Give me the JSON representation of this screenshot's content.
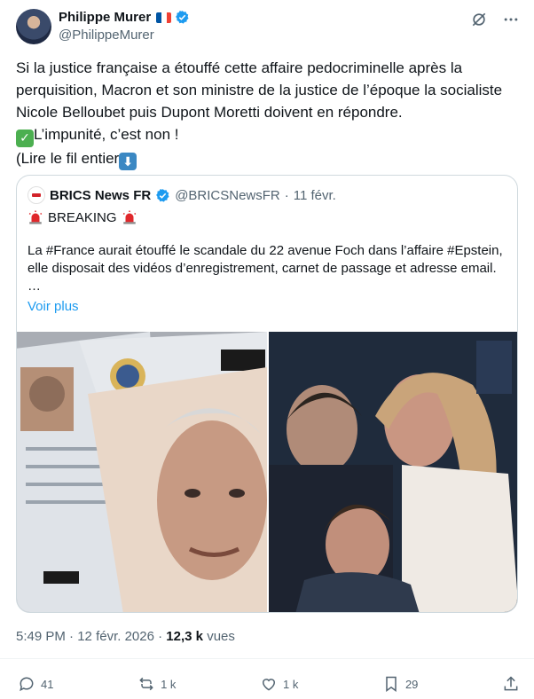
{
  "author": {
    "display_name": "Philippe Murer",
    "handle": "@PhilippeMurer",
    "flag": "france-flag",
    "verified": true
  },
  "tweet": {
    "line1": "Si la justice française a étouffé cette affaire pedocriminelle après la perquisition, Macron et son ministre de la justice  de l’époque la socialiste Nicole Belloubet puis Dupont Moretti doivent en répondre.",
    "line2": "L’impunité, c’est non !",
    "line3": "(Lire le fil entier"
  },
  "quote": {
    "display_name": "BRICS News FR",
    "handle": "@BRICSNewsFR",
    "separator": "·",
    "date": "11 févr.",
    "breaking": "BREAKING",
    "body": "La #France aurait étouffé le scandale du 22 avenue Foch dans l’affaire #Epstein, elle disposait des vidéos d’enregistrement, carnet de passage et adresse email. …",
    "more": "Voir plus"
  },
  "meta": {
    "time": "5:49 PM",
    "separator": "·",
    "date": "12 févr. 2026",
    "separator2": "·",
    "views_count": "12,3 k",
    "views_label": "vues"
  },
  "actions": {
    "replies": "41",
    "reposts": "1 k",
    "likes": "1 k",
    "bookmarks": "29"
  },
  "colors": {
    "accent": "#1d9bf0",
    "text": "#0f1419",
    "muted": "#536471",
    "border": "#cfd9de",
    "check_emoji": "#4caf50",
    "arrow_emoji": "#3b88c3",
    "siren": "#e0272b"
  },
  "icons": [
    "grok-icon",
    "more-icon",
    "reply-icon",
    "repost-icon",
    "like-icon",
    "bookmark-icon",
    "share-icon",
    "verified-icon",
    "siren-icon"
  ]
}
